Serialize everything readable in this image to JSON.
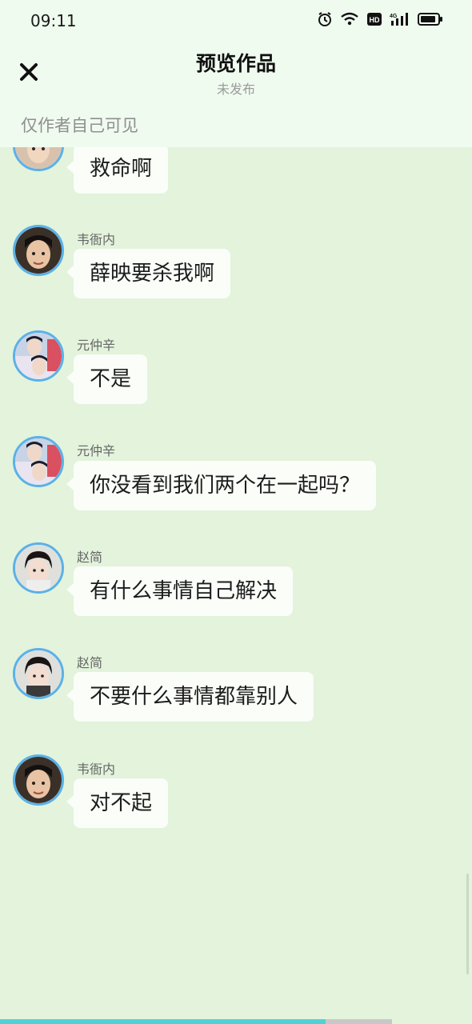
{
  "status_bar": {
    "time": "09:11"
  },
  "header": {
    "title": "预览作品",
    "subtitle": "未发布",
    "visibility_note": "仅作者自己可见"
  },
  "messages": [
    {
      "sender": "",
      "text": "救命啊",
      "avatar": "avatar-a"
    },
    {
      "sender": "韦衙内",
      "text": "薛映要杀我啊",
      "avatar": "avatar-wei"
    },
    {
      "sender": "元仲辛",
      "text": "不是",
      "avatar": "avatar-yuan"
    },
    {
      "sender": "元仲辛",
      "text": "你没看到我们两个在一起吗？",
      "avatar": "avatar-yuan"
    },
    {
      "sender": "赵简",
      "text": "有什么事情自己解决",
      "avatar": "avatar-zhao"
    },
    {
      "sender": "赵简",
      "text": "不要什么事情都靠别人",
      "avatar": "avatar-zhao"
    },
    {
      "sender": "韦衙内",
      "text": "对不起",
      "avatar": "avatar-wei"
    }
  ],
  "progress": {
    "value_fraction": 0.69
  },
  "colors": {
    "accent": "#5ab1e8",
    "progress": "#4fd2d6",
    "background": "#e3f3dc"
  }
}
